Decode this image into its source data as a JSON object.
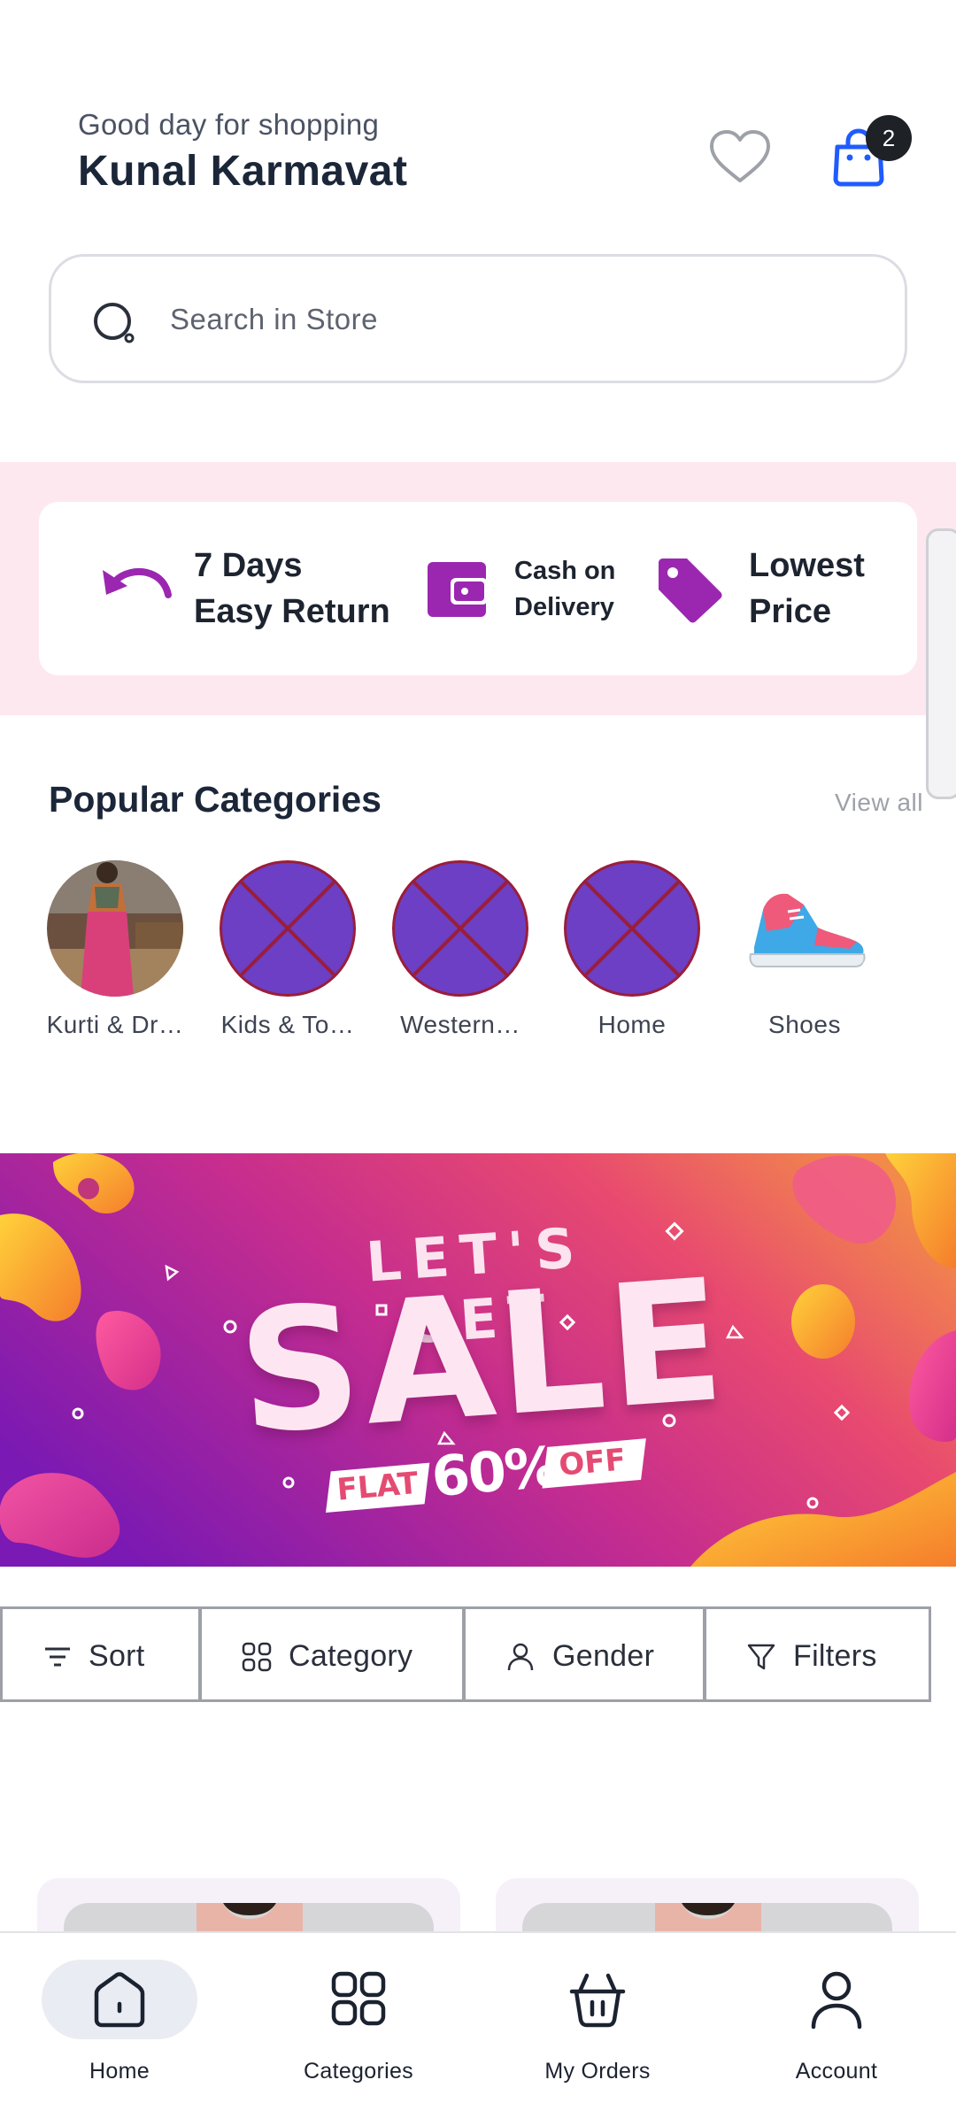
{
  "header": {
    "greeting": "Good day for shopping",
    "user_name": "Kunal Karmavat",
    "cart_count": "2"
  },
  "search": {
    "placeholder": "Search in Store"
  },
  "benefits": [
    {
      "line1": "7 Days",
      "line2": "Easy Return",
      "icon": "undo-arrow-icon"
    },
    {
      "line1": "Cash on",
      "line2": "Delivery",
      "icon": "wallet-icon"
    },
    {
      "line1": "Lowest",
      "line2": "Price",
      "icon": "price-tag-icon"
    }
  ],
  "popular_categories": {
    "title": "Popular Categories",
    "view_all": "View all",
    "items": [
      {
        "label": "Kurti & Dr…"
      },
      {
        "label": "Kids & To…"
      },
      {
        "label": "Western…"
      },
      {
        "label": "Home"
      },
      {
        "label": "Shoes"
      }
    ]
  },
  "banner": {
    "line1": "LET'S GET",
    "line2": "SALE",
    "flat": "FLAT",
    "percent": "60%",
    "off": "OFF"
  },
  "filters": {
    "sort": "Sort",
    "category": "Category",
    "gender": "Gender",
    "filters": "Filters"
  },
  "bottom_nav": {
    "home": "Home",
    "categories": "Categories",
    "orders": "My Orders",
    "account": "Account",
    "active": "Home"
  },
  "colors": {
    "accent_purple": "#9b27b0",
    "cart_blue": "#1f5bff",
    "benefit_band": "#fde8ef",
    "placeholder_purple": "#6c3fc4"
  }
}
